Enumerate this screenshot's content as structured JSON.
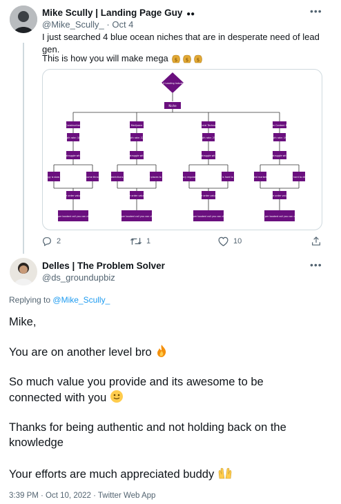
{
  "tweet": {
    "author_name": "Mike Scully | Landing Page Guy",
    "author_handle": "@Mike_Scully_",
    "date": "· Oct 4",
    "line1": "I just searched 4 blue ocean niches that are in desperate need of lead gen.",
    "line2": "This is how you will make mega",
    "reply_count": "2",
    "retweet_count": "1",
    "like_count": "10"
  },
  "diagram": {
    "root": "Top 4 Leading Industries",
    "hub": "Niche",
    "branches": [
      {
        "industry": "Construction",
        "growth": "Growth rate: 18.7%",
        "question": "Why they struggle with lead gen",
        "left": "Technology is slow to adapt",
        "right": "Their leads come through referrals",
        "avg": "Average order value: $50K",
        "outcome": "This means per booked call you can charge $3000"
      },
      {
        "industry": "Marijuana",
        "growth": "Growth rate: 22.9%",
        "question": "Why they struggle with lead gen",
        "left": "Strict restrictions on ads",
        "right": "Limited places to market",
        "avg": "Average order value: $25K",
        "outcome": "This means per booked call you can charge $1500"
      },
      {
        "industry": "Financial Technology",
        "growth": "Growth rate: 25.5%",
        "question": "Why they struggle with lead gen",
        "left": "Privacy regulations",
        "right": "Trust is hard to build",
        "avg": "Average order value: $10K",
        "outcome": "This means per booked call you can charge $1000"
      },
      {
        "industry": "Short Form Content Marketing",
        "growth": "Growth rate: 19.2%",
        "question": "Why they struggle with lead gen",
        "left": "Crowded market noise",
        "right": "Content is hard to differentiate",
        "avg": "Average order value: $5K",
        "outcome": "This means per booked call you can charge $500"
      }
    ]
  },
  "reply": {
    "author_name": "Delles | The Problem Solver",
    "author_handle": "@ds_groundupbiz",
    "replying_prefix": "Replying to",
    "replying_to": "@Mike_Scully_",
    "p1": "Mike,",
    "p2": "You are on another level bro",
    "p3": "So much value you provide and its awesome to be connected with you",
    "p4": "Thanks for being authentic and not holding back on the knowledge",
    "p5": "Your efforts are much appreciated buddy",
    "meta": "3:39 PM · Oct 10, 2022 · Twitter Web App"
  },
  "colors": {
    "purple": "#6a0f7e",
    "link": "#1d9bf0",
    "muted": "#536471"
  },
  "icons": [
    "more-icon",
    "reply-icon",
    "retweet-icon",
    "like-icon",
    "share-icon",
    "moneybag-icon",
    "fire-icon",
    "smile-icon",
    "raised-hands-icon"
  ]
}
